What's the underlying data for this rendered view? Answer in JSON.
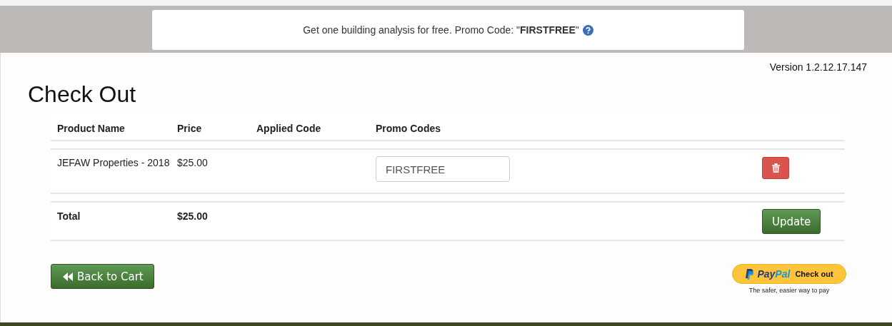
{
  "banner": {
    "text": "Get one building analysis for free. Promo Code: \"**FIRSTFREE**\""
  },
  "version": "Version 1.2.12.17.147",
  "title": "Check Out",
  "table": {
    "columns": [
      "Product Name",
      "Price",
      "Applied Code",
      "Promo Codes"
    ],
    "rows": [
      {
        "product": "JEFAW Properties - 2018",
        "price": "$25.00",
        "promo_code": "FIRSTFREE"
      }
    ],
    "total": {
      "label": "Total",
      "price": "$25.00"
    },
    "update_button": "Update"
  },
  "back_button": "Back to Cart",
  "paypal": {
    "logo_parts": [
      "Pay",
      "Pal"
    ],
    "label": "Check out",
    "tagline": "The safer, easier way to pay"
  }
}
